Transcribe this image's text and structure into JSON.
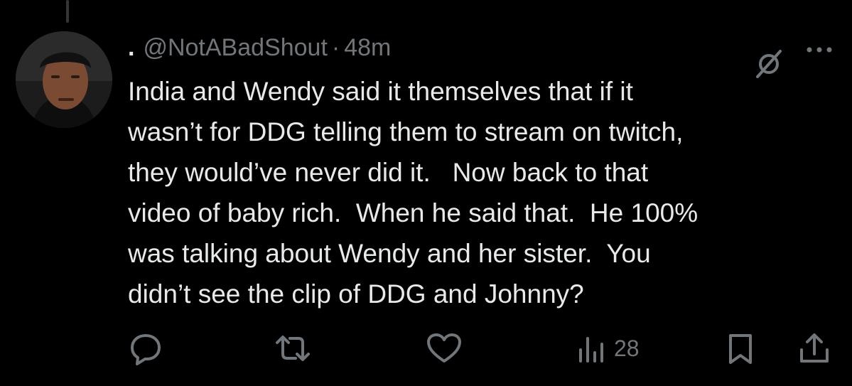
{
  "tweet": {
    "display_name": ".",
    "handle": "@NotABadShout",
    "separator": "·",
    "time": "48m",
    "text": "India and Wendy said it themselves that if it\nwasn’t for DDG telling them to stream on twitch,\nthey would’ve never did it.   Now back to that\nvideo of baby rich.  When he said that.  He 100%\nwas talking about Wendy and her sister.  You\ndidn’t see the clip of DDG and Johnny?"
  },
  "actions": {
    "reply_icon": "reply-icon",
    "retweet_icon": "retweet-icon",
    "like_icon": "heart-icon",
    "views_icon": "views-chart-icon",
    "views_count": "28",
    "bookmark_icon": "bookmark-icon",
    "share_icon": "share-icon"
  },
  "header_icons": {
    "mute": "muted-circle-icon",
    "more": "more-dots-icon"
  },
  "colors": {
    "background": "#000000",
    "text_primary": "#e7e9ea",
    "text_secondary": "#71767b",
    "thread_line": "#333639"
  }
}
